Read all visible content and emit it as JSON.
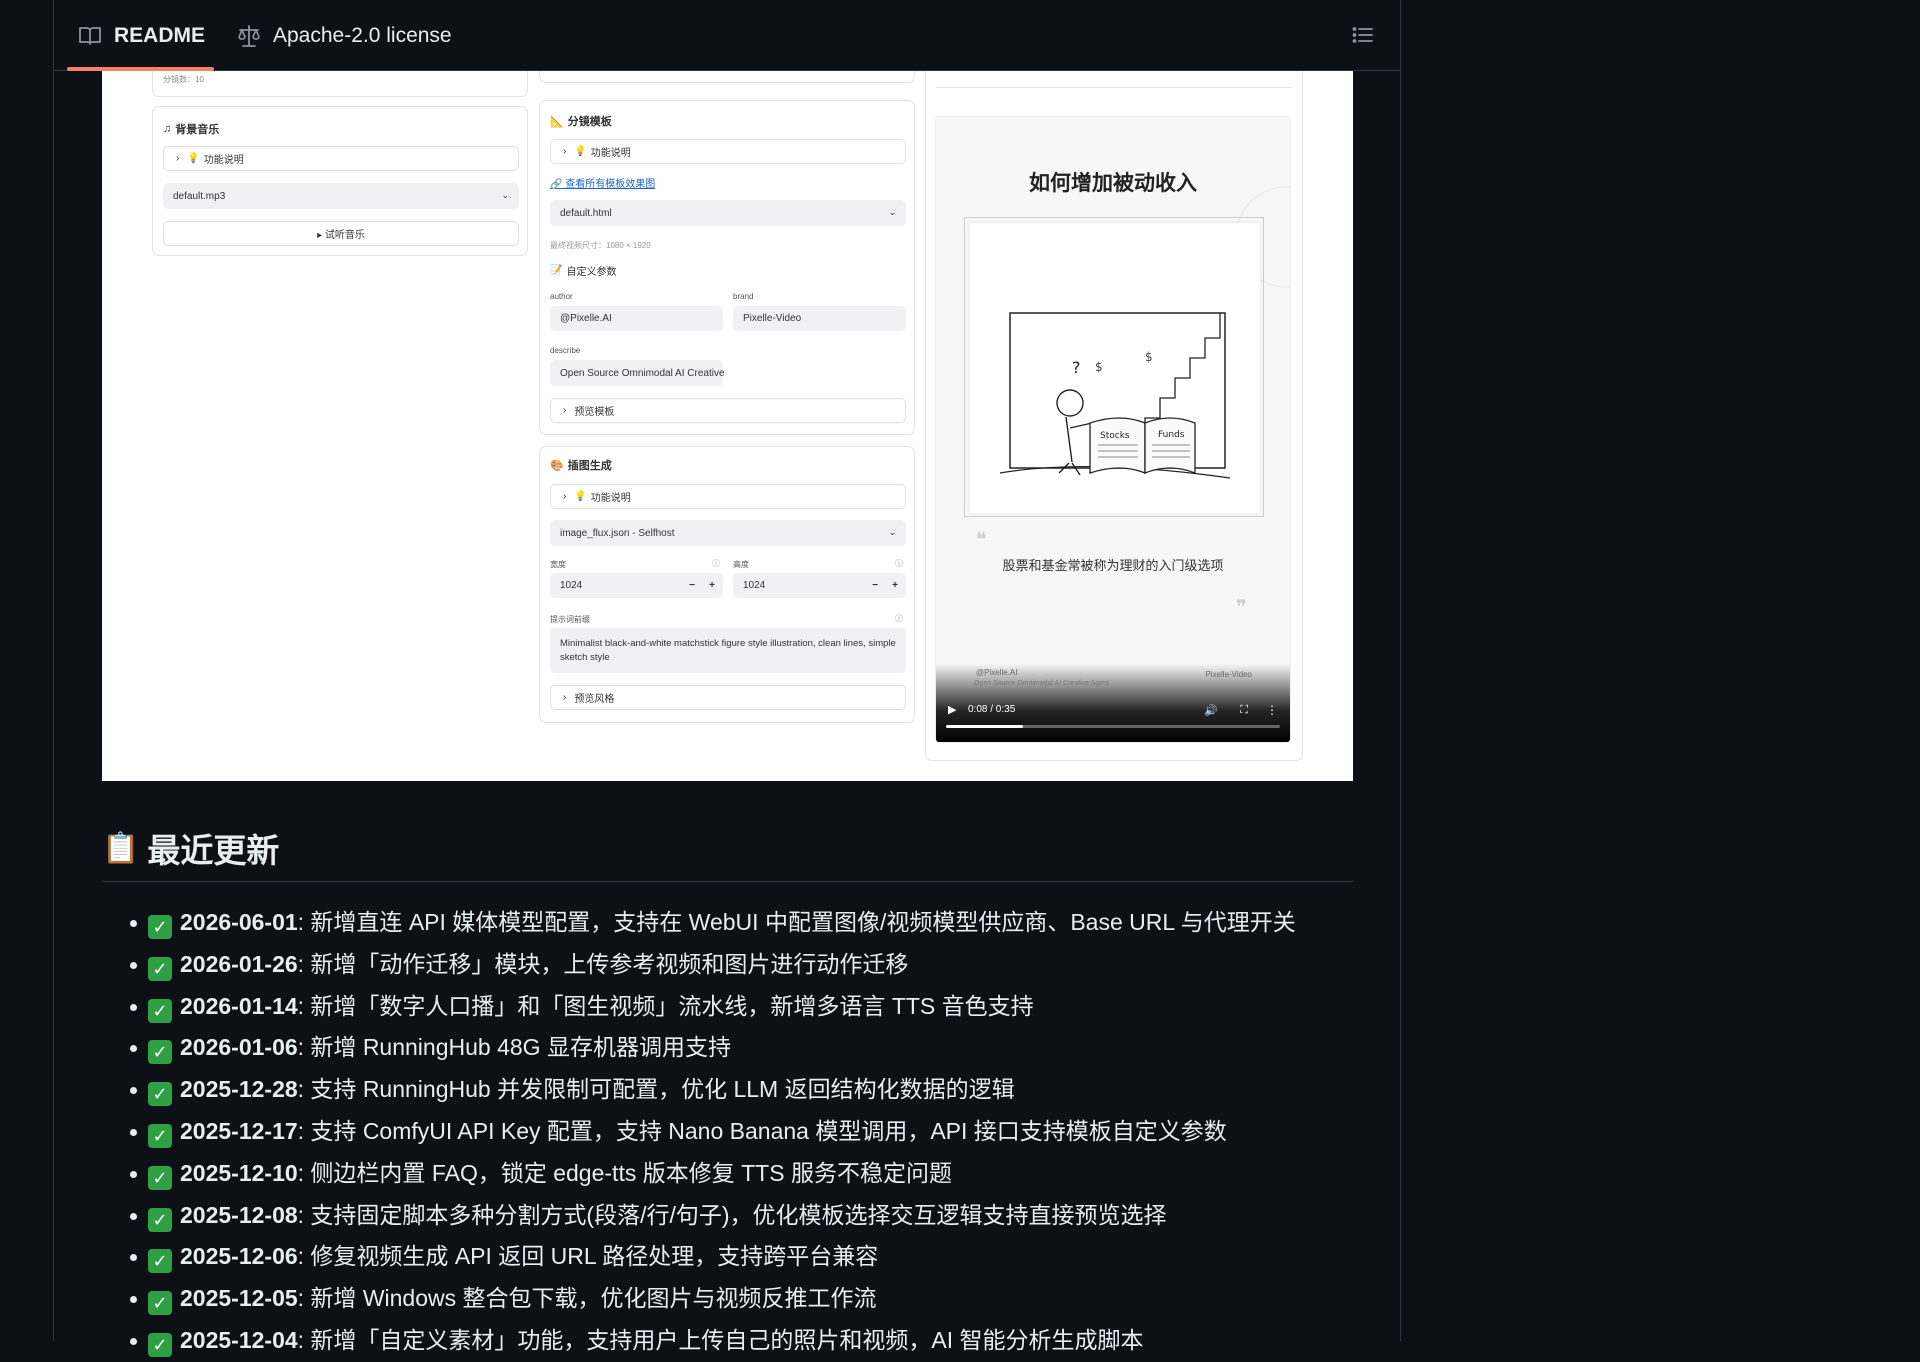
{
  "tabs": {
    "readme": "README",
    "license": "Apache-2.0 license"
  },
  "screenshot": {
    "left": {
      "segment_count": "分镜数：10",
      "bgm_title": "背景音乐",
      "func_desc": "功能说明",
      "bgm_file": "default.mp3",
      "preview_music": "▸ 试听音乐"
    },
    "middle": {
      "storyboard_title": "分镜模板",
      "func_desc": "功能说明",
      "view_all_link": "查看所有模板效果图",
      "template_file": "default.html",
      "video_size": "最终视频尺寸：1080 × 1920",
      "custom_params": "自定义参数",
      "author_label": "author",
      "author_value": "@Pixelle.AI",
      "brand_label": "brand",
      "brand_value": "Pixelle-Video",
      "describe_label": "describe",
      "describe_value": "Open Source Omnimodal AI Creative",
      "preview_template": "预览模板",
      "illustration_title": "插图生成",
      "func_desc2": "功能说明",
      "workflow": "image_flux.json - Selfhost",
      "width_label": "宽度",
      "width_value": "1024",
      "height_label": "高度",
      "height_value": "1024",
      "prompt_label": "提示词前缀",
      "prompt_value": "Minimalist black-and-white matchstick figure style illustration, clean lines, simple sketch style",
      "preview_style": "预览风格"
    },
    "video": {
      "title": "如何增加被动收入",
      "caption": "股票和基金常被称为理财的入门级选项",
      "footer_author": "@Pixelle.AI",
      "footer_tagline": "Open Source Omnimodal AI Creative Agent",
      "footer_brand": "Pixelle-Video",
      "book_left": "Stocks",
      "book_right": "Funds",
      "time": "0:08 / 0:35",
      "progress": 0.23
    }
  },
  "section": {
    "title": "最近更新",
    "updates": [
      {
        "date": "2026-06-01",
        "text": ": 新增直连 API 媒体模型配置，支持在 WebUI 中配置图像/视频模型供应商、Base URL 与代理开关"
      },
      {
        "date": "2026-01-26",
        "text": ": 新增「动作迁移」模块，上传参考视频和图片进行动作迁移"
      },
      {
        "date": "2026-01-14",
        "text": ": 新增「数字人口播」和「图生视频」流水线，新增多语言 TTS 音色支持"
      },
      {
        "date": "2026-01-06",
        "text": ": 新增 RunningHub 48G 显存机器调用支持"
      },
      {
        "date": "2025-12-28",
        "text": ": 支持 RunningHub 并发限制可配置，优化 LLM 返回结构化数据的逻辑"
      },
      {
        "date": "2025-12-17",
        "text": ": 支持 ComfyUI API Key 配置，支持 Nano Banana 模型调用，API 接口支持模板自定义参数"
      },
      {
        "date": "2025-12-10",
        "text": ": 侧边栏内置 FAQ，锁定 edge-tts 版本修复 TTS 服务不稳定问题"
      },
      {
        "date": "2025-12-08",
        "text": ": 支持固定脚本多种分割方式(段落/行/句子)，优化模板选择交互逻辑支持直接预览选择"
      },
      {
        "date": "2025-12-06",
        "text": ": 修复视频生成 API 返回 URL 路径处理，支持跨平台兼容"
      },
      {
        "date": "2025-12-05",
        "text": ": 新增 Windows 整合包下载，优化图片与视频反推工作流"
      },
      {
        "date": "2025-12-04",
        "text": ": 新增「自定义素材」功能，支持用户上传自己的照片和视频，AI 智能分析生成脚本"
      }
    ]
  }
}
